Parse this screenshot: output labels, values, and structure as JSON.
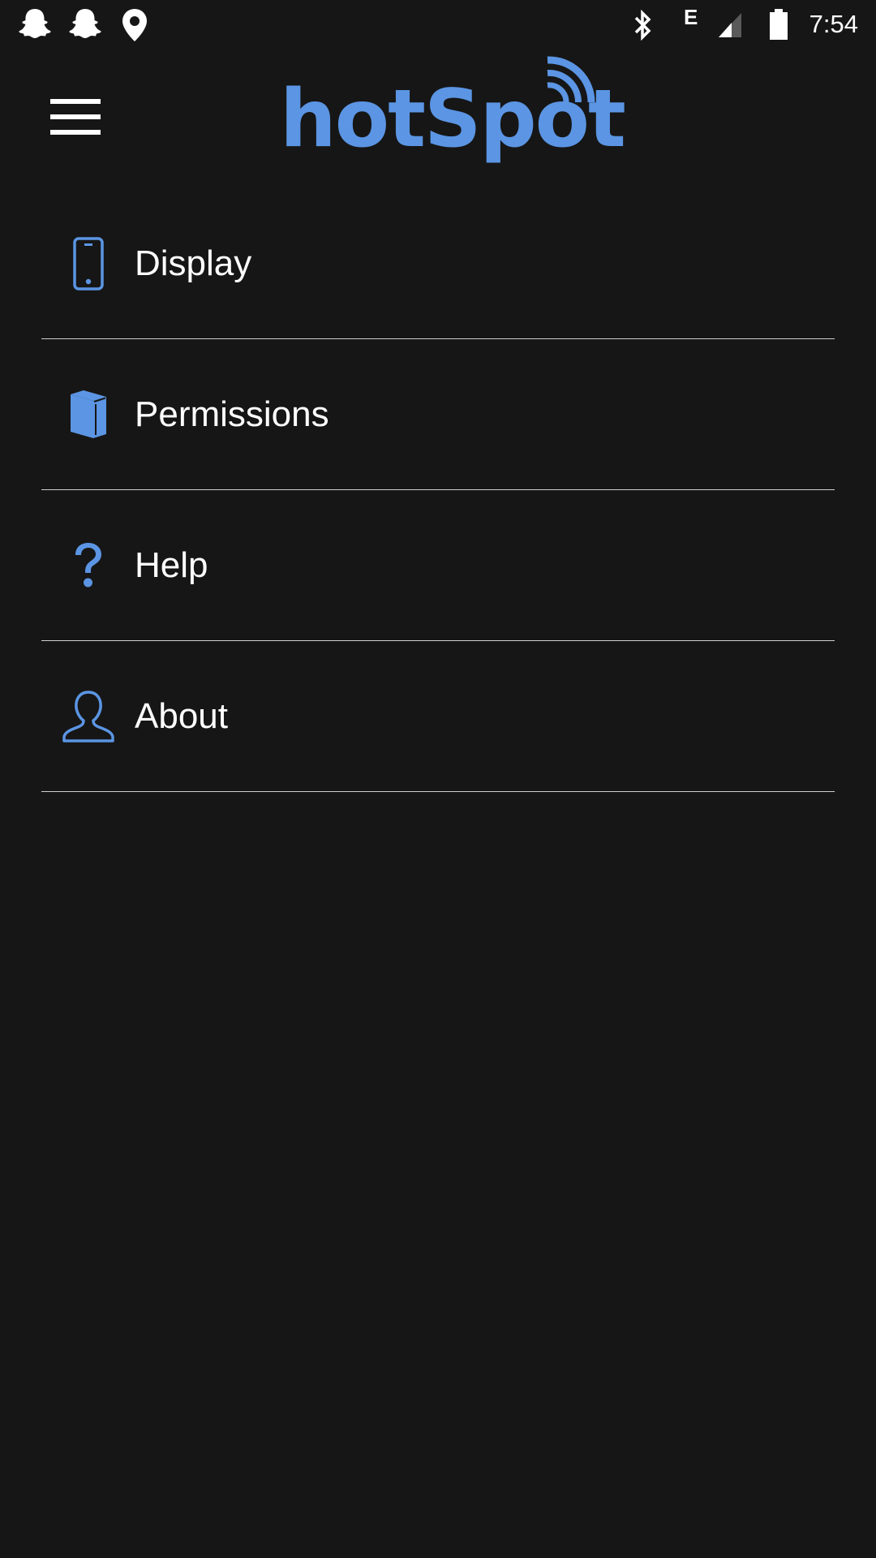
{
  "status_bar": {
    "time": "7:54",
    "network_type": "E",
    "left_icons": [
      "snapchat-icon",
      "snapchat-icon",
      "location-pin-icon"
    ],
    "right_icons": [
      "bluetooth-icon",
      "signal-icon",
      "battery-icon"
    ]
  },
  "header": {
    "menu_icon": "hamburger-menu-icon",
    "logo_text": "hotSpot",
    "logo_icon": "wifi-waves-icon"
  },
  "colors": {
    "background": "#161616",
    "accent": "#5b95e3",
    "text": "#ffffff",
    "divider": "#cfcfcf"
  },
  "menu": {
    "items": [
      {
        "label": "Display",
        "icon": "phone-icon"
      },
      {
        "label": "Permissions",
        "icon": "book-icon"
      },
      {
        "label": "Help",
        "icon": "question-mark-icon"
      },
      {
        "label": "About",
        "icon": "user-icon"
      }
    ]
  }
}
